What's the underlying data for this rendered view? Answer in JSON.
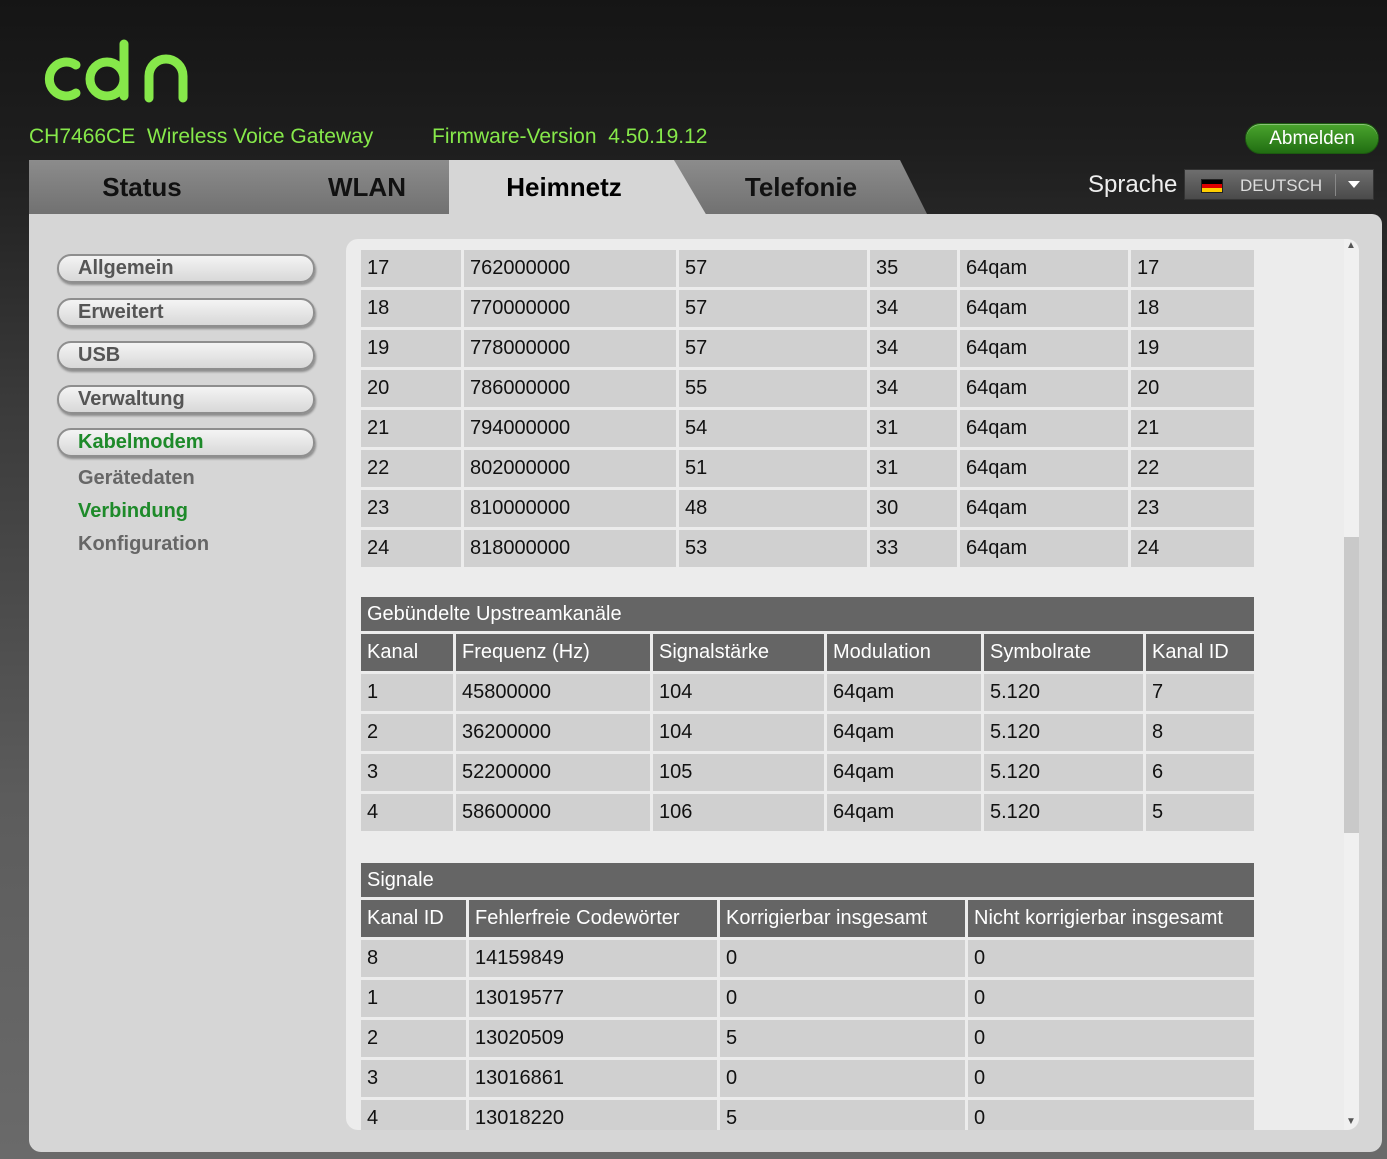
{
  "header": {
    "logo": "cbn",
    "model": "CH7466CE  Wireless Voice Gateway",
    "firmware": "Firmware-Version  4.50.19.12",
    "logout_label": "Abmelden",
    "language_label": "Sprache",
    "language_value": "DEUTSCH",
    "brand_color": "#86e84a"
  },
  "tabs": [
    {
      "label": "Status"
    },
    {
      "label": "WLAN"
    },
    {
      "label": "Heimnetz",
      "active": true
    },
    {
      "label": "Telefonie"
    }
  ],
  "sidebar": {
    "buttons": [
      {
        "label": "Allgemein"
      },
      {
        "label": "Erweitert"
      },
      {
        "label": "USB"
      },
      {
        "label": "Verwaltung"
      },
      {
        "label": "Kabelmodem",
        "active": true
      }
    ],
    "sub_items": [
      {
        "label": "Gerätedaten"
      },
      {
        "label": "Verbindung",
        "active": true
      },
      {
        "label": "Konfiguration"
      }
    ]
  },
  "downstream": {
    "rows": [
      [
        "17",
        "762000000",
        "57",
        "35",
        "64qam",
        "17"
      ],
      [
        "18",
        "770000000",
        "57",
        "34",
        "64qam",
        "18"
      ],
      [
        "19",
        "778000000",
        "57",
        "34",
        "64qam",
        "19"
      ],
      [
        "20",
        "786000000",
        "55",
        "34",
        "64qam",
        "20"
      ],
      [
        "21",
        "794000000",
        "54",
        "31",
        "64qam",
        "21"
      ],
      [
        "22",
        "802000000",
        "51",
        "31",
        "64qam",
        "22"
      ],
      [
        "23",
        "810000000",
        "48",
        "30",
        "64qam",
        "23"
      ],
      [
        "24",
        "818000000",
        "53",
        "33",
        "64qam",
        "24"
      ]
    ]
  },
  "upstream": {
    "title": "Gebündelte Upstreamkanäle",
    "headers": [
      "Kanal",
      "Frequenz (Hz)",
      "Signalstärke",
      "Modulation",
      "Symbolrate",
      "Kanal ID"
    ],
    "rows": [
      [
        "1",
        "45800000",
        "104",
        "64qam",
        "5.120",
        "7"
      ],
      [
        "2",
        "36200000",
        "104",
        "64qam",
        "5.120",
        "8"
      ],
      [
        "3",
        "52200000",
        "105",
        "64qam",
        "5.120",
        "6"
      ],
      [
        "4",
        "58600000",
        "106",
        "64qam",
        "5.120",
        "5"
      ]
    ]
  },
  "signals": {
    "title": "Signale",
    "headers": [
      "Kanal ID",
      "Fehlerfreie Codewörter",
      "Korrigierbar insgesamt",
      "Nicht korrigierbar insgesamt"
    ],
    "rows": [
      [
        "8",
        "14159849",
        "0",
        "0"
      ],
      [
        "1",
        "13019577",
        "0",
        "0"
      ],
      [
        "2",
        "13020509",
        "5",
        "0"
      ],
      [
        "3",
        "13016861",
        "0",
        "0"
      ],
      [
        "4",
        "13018220",
        "5",
        "0"
      ]
    ]
  }
}
